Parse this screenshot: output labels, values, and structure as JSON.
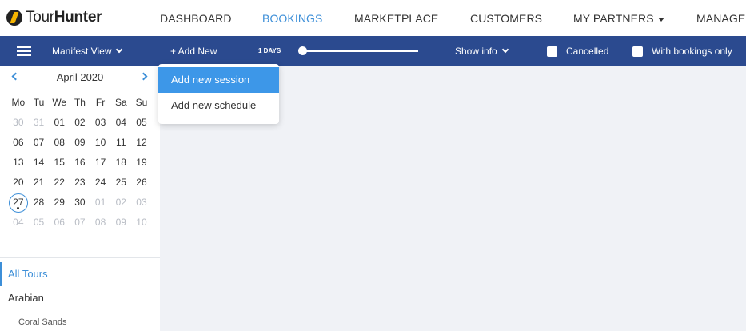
{
  "logo": {
    "part1": "Tour",
    "part2": "Hunter"
  },
  "nav": {
    "dashboard": "DASHBOARD",
    "bookings": "BOOKINGS",
    "marketplace": "MARKETPLACE",
    "customers": "CUSTOMERS",
    "my_partners": "MY PARTNERS",
    "manage": "MANAGE"
  },
  "toolbar": {
    "view_label": "Manifest View",
    "add_new": "+ Add New",
    "days_label": "1 DAYS",
    "show_info": "Show info",
    "cancelled": "Cancelled",
    "with_bookings_only": "With bookings only",
    "days_slider_value": 1
  },
  "dropdown": {
    "add_session": "Add new session",
    "add_schedule": "Add new schedule"
  },
  "calendar": {
    "title": "April 2020",
    "weekdays": [
      "Mo",
      "Tu",
      "We",
      "Th",
      "Fr",
      "Sa",
      "Su"
    ],
    "weeks": [
      [
        "30",
        "31",
        "01",
        "02",
        "03",
        "04",
        "05"
      ],
      [
        "06",
        "07",
        "08",
        "09",
        "10",
        "11",
        "12"
      ],
      [
        "13",
        "14",
        "15",
        "16",
        "17",
        "18",
        "19"
      ],
      [
        "20",
        "21",
        "22",
        "23",
        "24",
        "25",
        "26"
      ],
      [
        "27",
        "28",
        "29",
        "30",
        "01",
        "02",
        "03"
      ],
      [
        "04",
        "05",
        "06",
        "07",
        "08",
        "09",
        "10"
      ]
    ],
    "today": "27"
  },
  "tours": {
    "all": "All Tours",
    "group": "Arabian",
    "sub": "Coral Sands"
  },
  "colors": {
    "toolbar_bg": "#2b4a8f",
    "accent": "#3d8fd8",
    "main_bg": "#f0f2f6"
  }
}
